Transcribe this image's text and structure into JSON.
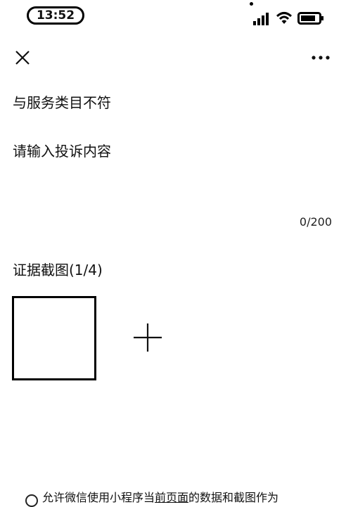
{
  "status_bar": {
    "time": "13:52"
  },
  "complaint": {
    "category": "与服务类目不符",
    "placeholder": "请输入投诉内容",
    "counter": "0/200"
  },
  "evidence": {
    "title": "证据截图(1/4)"
  },
  "consent": {
    "prefix": "允许微信使用小程序当",
    "link": "前页面",
    "suffix": "的数据和截图作为"
  },
  "icons": {
    "close": "close-icon",
    "more": "more-icon",
    "add": "plus-icon",
    "signal": "signal-icon",
    "wifi": "wifi-icon",
    "battery": "battery-icon"
  }
}
